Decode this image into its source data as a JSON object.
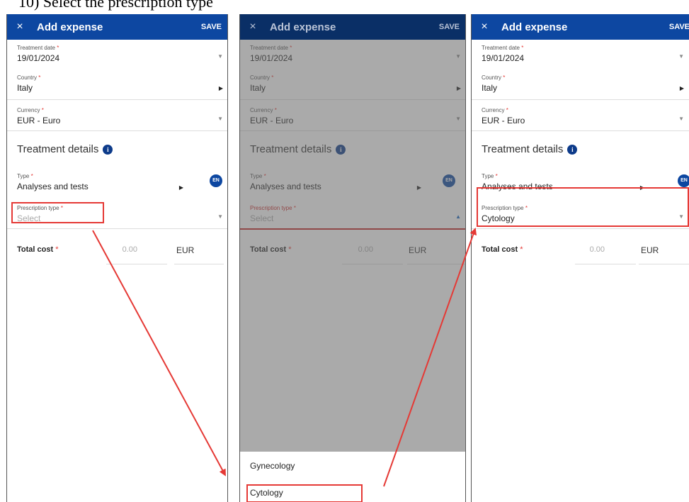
{
  "step_title": "10) Select the prescription type",
  "appbar": {
    "close": "×",
    "title": "Add expense",
    "save": "SAVE"
  },
  "fields": {
    "treatment_date": {
      "label": "Treatment date",
      "required": "*",
      "value": "19/01/2024"
    },
    "country": {
      "label": "Country",
      "required": "*",
      "value": "Italy"
    },
    "currency": {
      "label": "Currency",
      "required": "*",
      "value": "EUR - Euro"
    },
    "type": {
      "label": "Type",
      "required": "*",
      "value": "Analyses and tests"
    },
    "prescription_type": {
      "label": "Prescription type",
      "required": "*",
      "placeholder": "Select",
      "selected": "Cytology"
    }
  },
  "section": {
    "treatment_details": "Treatment details",
    "info": "i"
  },
  "language_badge": "EN",
  "total": {
    "label": "Total cost",
    "required": "*",
    "amount": "0.00",
    "currency": "EUR"
  },
  "dropdown_options": [
    "Gynecology",
    "Cytology"
  ],
  "colors": {
    "appbar": "#0d47a1",
    "highlight": "#e53935",
    "required": "#e53935"
  },
  "icons": {
    "close": "close-icon",
    "dropdown": "caret-down-icon",
    "next": "caret-right-icon",
    "info": "info-icon"
  }
}
